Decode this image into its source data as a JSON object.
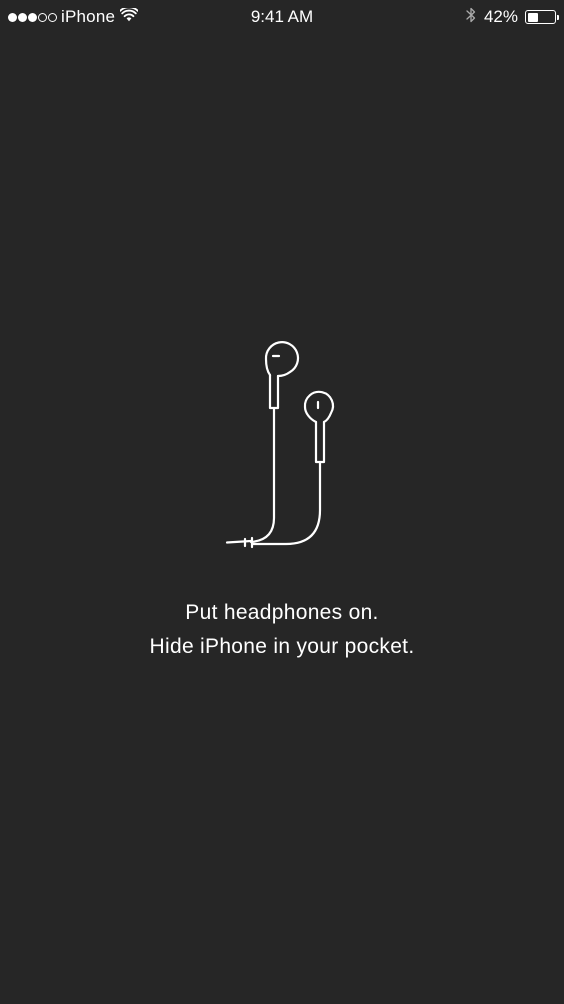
{
  "status_bar": {
    "carrier": "iPhone",
    "time": "9:41 AM",
    "battery_percent": "42%",
    "battery_level": 0.42,
    "signal_bars_filled": 3,
    "signal_bars_total": 5,
    "icons": [
      "signal-dots-icon",
      "wifi-icon",
      "bluetooth-icon",
      "battery-icon"
    ]
  },
  "illustration": {
    "icon": "earphones-icon"
  },
  "message": {
    "line1": "Put headphones on.",
    "line2": "Hide iPhone in your pocket."
  },
  "colors": {
    "background": "#262626",
    "foreground": "#ffffff"
  }
}
